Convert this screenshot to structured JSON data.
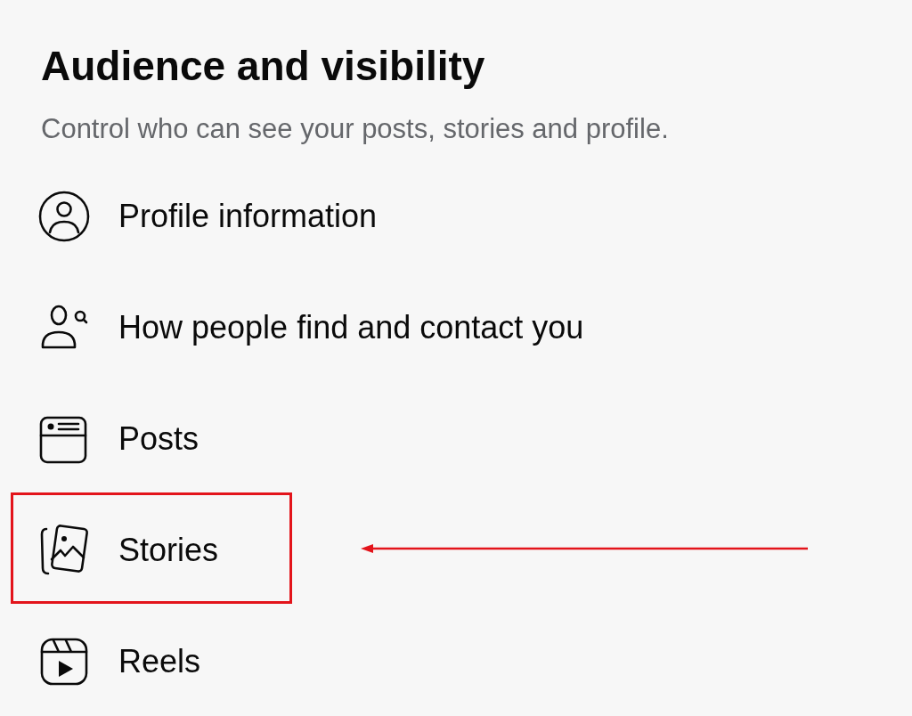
{
  "header": {
    "title": "Audience and visibility",
    "subtitle": "Control who can see your posts, stories and profile."
  },
  "items": [
    {
      "kind": "profile",
      "label": "Profile information",
      "highlighted": false
    },
    {
      "kind": "find",
      "label": "How people find and contact you",
      "highlighted": false
    },
    {
      "kind": "posts",
      "label": "Posts",
      "highlighted": false
    },
    {
      "kind": "stories",
      "label": "Stories",
      "highlighted": true
    },
    {
      "kind": "reels",
      "label": "Reels",
      "highlighted": false
    }
  ]
}
